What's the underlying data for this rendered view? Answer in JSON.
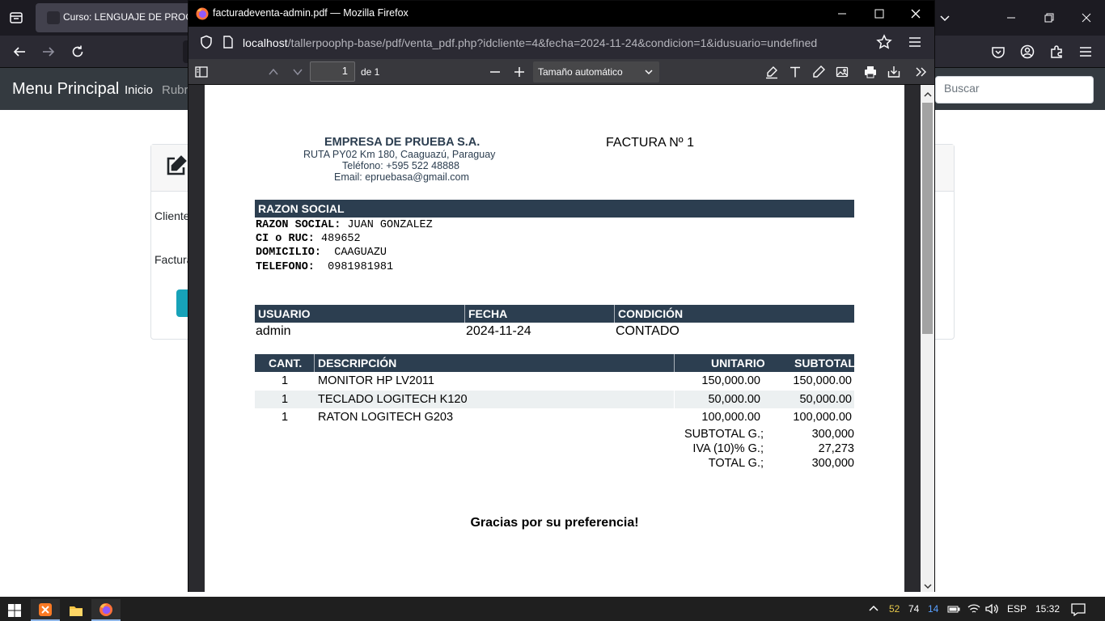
{
  "background_browser": {
    "tab_title": "Curso: LENGUAJE DE PROGRA",
    "app_nav": {
      "brand": "Menu Principal",
      "links": [
        "Inicio",
        "Rubro"
      ],
      "search_placeholder": "Buscar"
    },
    "card": {
      "label_1": "Cliente",
      "label_2": "Factura"
    }
  },
  "pdf_window": {
    "title": "facturadeventa-admin.pdf — Mozilla Firefox",
    "url_host": "localhost",
    "url_path": "/tallerpoophp-base/pdf/venta_pdf.php?idcliente=4&fecha=2024-11-24&condicion=1&idusuario=undefined",
    "toolbar": {
      "page_number": "1",
      "page_of": "de 1",
      "zoom": "Tamaño automático"
    }
  },
  "invoice": {
    "company": {
      "name": "EMPRESA DE PRUEBA S.A.",
      "address": "RUTA PY02 Km 180, Caaguazú, Paraguay",
      "phone": "Teléfono: +595 522 48888",
      "email": "Email: epruebasa@gmail.com"
    },
    "title": "FACTURA Nº 1",
    "customer_header": "RAZON SOCIAL",
    "customer": {
      "razon_label": "RAZON SOCIAL:",
      "razon_value": " JUAN GONZALEZ",
      "ruc_label": "CI o RUC:",
      "ruc_value": " 489652",
      "domicilio_label": "DOMICILIO:",
      "domicilio_value": "  CAAGUAZU",
      "telefono_label": "TELEFONO:",
      "telefono_value": "  0981981981"
    },
    "meta_headers": [
      "USUARIO",
      "FECHA",
      "CONDICIÓN"
    ],
    "meta_values": [
      "admin",
      "2024-11-24",
      "CONTADO"
    ],
    "items_headers": [
      "CANT.",
      "DESCRIPCIÓN",
      "UNITARIO",
      "SUBTOTAL"
    ],
    "items": [
      {
        "qty": "1",
        "description": "MONITOR HP LV2011",
        "unit": "150,000.00",
        "subtotal": "150,000.00"
      },
      {
        "qty": "1",
        "description": "TECLADO LOGITECH K120",
        "unit": "50,000.00",
        "subtotal": "50,000.00"
      },
      {
        "qty": "1",
        "description": "RATON LOGITECH G203",
        "unit": "100,000.00",
        "subtotal": "100,000.00"
      }
    ],
    "totals": [
      {
        "label": "SUBTOTAL G.;",
        "value": "300,000"
      },
      {
        "label": "IVA (10)% G.;",
        "value": "27,273"
      },
      {
        "label": "TOTAL G.;",
        "value": "300,000"
      }
    ],
    "thanks": "Gracias por su preferencia!"
  },
  "taskbar": {
    "tray_numbers": [
      "52",
      "74",
      "14"
    ],
    "language": "ESP",
    "time": "15:32"
  },
  "colors": {
    "invoice_band": "#2c3e50",
    "row_alt": "#ecf0f1",
    "pdf_toolbar": "#38383d"
  }
}
